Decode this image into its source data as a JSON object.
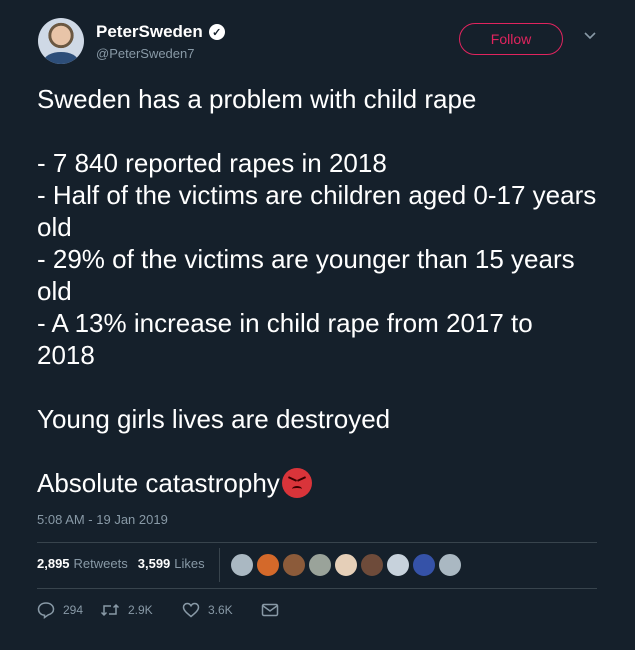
{
  "author": {
    "name": "PeterSweden",
    "handle": "@PeterSweden7",
    "follow_label": "Follow"
  },
  "tweet": {
    "lines": [
      "Sweden has a problem with child rape",
      "",
      "- 7 840 reported rapes in 2018",
      "- Half of the victims are children aged 0-17 years old",
      "- 29% of the victims are younger than 15 years old",
      "- A 13% increase in child rape from 2017 to 2018",
      "",
      "Young girls lives are destroyed",
      "",
      "Absolute catastrophy"
    ],
    "emoji": "angry-face-emoji",
    "timestamp": "5:08 AM - 19 Jan 2019"
  },
  "stats": {
    "retweets_count": "2,895",
    "retweets_label": "Retweets",
    "likes_count": "3,599",
    "likes_label": "Likes"
  },
  "likers": {
    "colors": [
      "#aab8c2",
      "#d4692a",
      "#8c5b3a",
      "#9aa39a",
      "#e5cfb8",
      "#6e4b3a",
      "#c7d2dc",
      "#3552a8",
      "#aab8c2"
    ]
  },
  "actions": {
    "replies": "294",
    "retweets": "2.9K",
    "likes": "3.6K"
  },
  "colors": {
    "background": "#15202b",
    "follow_accent": "#e0245e",
    "muted": "#8899a6"
  }
}
